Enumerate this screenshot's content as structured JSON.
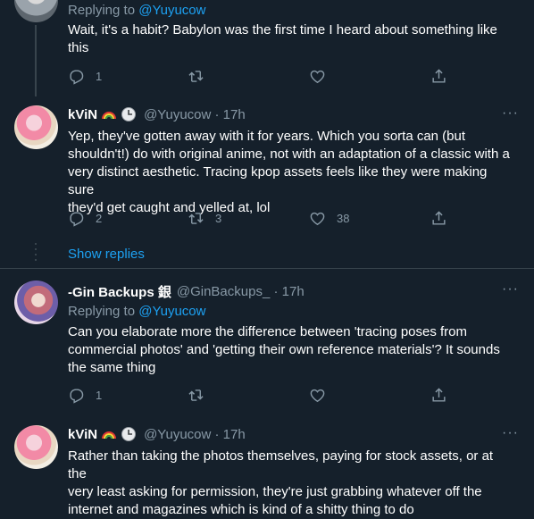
{
  "tweet1": {
    "replying_prefix": "Replying to ",
    "replying_mention": "@Yuyucow",
    "text_line1": "Wait, it's a habit? Babylon was the first time I heard about something like",
    "text_line2": "this",
    "reply_count": "1",
    "retweet_count": "",
    "like_count": ""
  },
  "tweet2": {
    "name": "kViN",
    "handle_time": "@Yuyucow · 17h",
    "text_lines": [
      "Yep, they've gotten away with it for years. Which you sorta can (but",
      "shouldn't!) do with original anime, not with an adaptation of a classic with a",
      "very distinct aesthetic. Tracing kpop assets feels like they were making sure",
      "they'd get caught and yelled at, lol"
    ],
    "reply_count": "2",
    "retweet_count": "3",
    "like_count": "38",
    "show_replies": "Show replies"
  },
  "tweet3": {
    "name": "-Gin Backups 銀",
    "handle_time": "@GinBackups_ · 17h",
    "replying_prefix": "Replying to ",
    "replying_mention": "@Yuyucow",
    "text_lines": [
      "Can you elaborate more the difference between 'tracing poses from",
      "commercial photos' and 'getting their own reference materials'? It sounds",
      "the same thing"
    ],
    "reply_count": "1",
    "retweet_count": "",
    "like_count": ""
  },
  "tweet4": {
    "name": "kViN",
    "handle_time": "@Yuyucow · 17h",
    "text_lines": [
      "Rather than taking the photos themselves, paying for stock assets, or at the",
      "very least asking for permission, they're just grabbing whatever off the",
      "internet and magazines which is kind of a shitty thing to do"
    ]
  },
  "more_label": "···",
  "colors": {
    "background": "#15202b",
    "text": "#ffffff",
    "secondary": "#8899a6",
    "accent": "#1da1f2",
    "border": "#38444d"
  }
}
